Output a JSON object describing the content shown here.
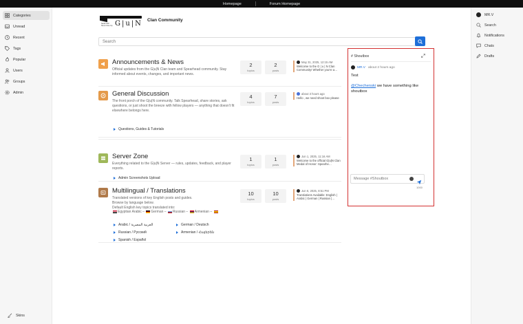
{
  "topbar": {
    "homepage": "Homepage",
    "forum_homepage": "Forum Homepage"
  },
  "leftnav": {
    "items": [
      {
        "label": "Categories",
        "icon": "categories-icon"
      },
      {
        "label": "Unread",
        "icon": "inbox-icon"
      },
      {
        "label": "Recent",
        "icon": "clock-icon"
      },
      {
        "label": "Tags",
        "icon": "tag-icon"
      },
      {
        "label": "Popular",
        "icon": "flame-icon"
      },
      {
        "label": "Users",
        "icon": "user-icon"
      },
      {
        "label": "Groups",
        "icon": "users-icon"
      },
      {
        "label": "Admin",
        "icon": "gear-icon"
      }
    ],
    "skins": "Skins"
  },
  "rightnav": {
    "user": "MR.V",
    "items": [
      {
        "label": "Search",
        "icon": "search-icon"
      },
      {
        "label": "Notifications",
        "icon": "bell-icon"
      },
      {
        "label": "Chats",
        "icon": "chat-icon"
      },
      {
        "label": "Drafts",
        "icon": "edit-icon"
      }
    ]
  },
  "brand": {
    "logo_text": "G|u|N",
    "logo_tagline": "Sarah Will Never Give Up",
    "name": "Clan Community"
  },
  "search": {
    "placeholder": "Search"
  },
  "categories": [
    {
      "title": "Announcements & News",
      "icon_color": "#f0a04b",
      "description": "Official updates from the G|u|N Clan team and Spearhead community. Stay informed about events, changes, and important news.",
      "topics": "2",
      "posts": "2",
      "topics_label": "topics",
      "posts_label": "posts",
      "teaser_time": "May 31, 2025, 12:15 AM",
      "teaser_text": "Welcome to the G | u | N Clan Community! Whether you're a…"
    },
    {
      "title": "General Discussion",
      "icon_color": "#e49a4a",
      "description": "The front porch of the G|u|N community. Talk Spearhead, share stories, ask questions, or just shoot the breeze with fellow players — anything that doesn't fit elsewhere belongs here.",
      "topics": "4",
      "posts": "7",
      "topics_label": "topics",
      "posts_label": "posts",
      "teaser_time": "about 3 hours ago",
      "teaser_text": "Hello , we need shoot box please",
      "subcategories": [
        "Questions, Guides & Tutorials"
      ]
    },
    {
      "title": "Server Zone",
      "icon_color": "#9fb85a",
      "description": "Everything related to the G|u|N Server — rules, updates, feedback, and player reports.",
      "topics": "1",
      "posts": "1",
      "topics_label": "topics",
      "posts_label": "posts",
      "teaser_time": "Jun 1, 2025, 11:16 AM",
      "teaser_text": "Welcome to the official G|u|N Clan Medal of Honor: Spearhe…",
      "subcategories": [
        "Admin Screenshots Upload"
      ]
    },
    {
      "title": "Multilingual / Translations",
      "icon_color": "#b07a4a",
      "description_lines": [
        "Translated versions of key English posts and guides.",
        "Browse by language below.",
        "Default English key topics translated into:"
      ],
      "languages_line": [
        "Egyptian Arabic –",
        "German –",
        "Russian –",
        "Armenian –"
      ],
      "topics": "10",
      "posts": "10",
      "topics_label": "topics",
      "posts_label": "posts",
      "teaser_time": "Jun 6, 2025, 8:51 PM",
      "teaser_text": "Translations Available: English | Arabic | German | Russian |…",
      "subcategories": [
        "Arabic / العربية المصرية",
        "German / Deutsch",
        "Russian / Русский",
        "Armenian / Հայերեն",
        "Spanish / Español"
      ]
    }
  ],
  "shoutbox": {
    "title": "# Shoutbox",
    "message_user": "MR.V",
    "message_time": "about 2 hours ago",
    "message_1": "Test",
    "message_2_mention": "@Chechenski",
    "message_2_text": " we have something like shoutbox",
    "input_placeholder": "Message #Shoutbox",
    "char_limit": "1000"
  },
  "colors": {
    "accent": "#1e6fd9",
    "highlight_border": "#d32f2f"
  }
}
